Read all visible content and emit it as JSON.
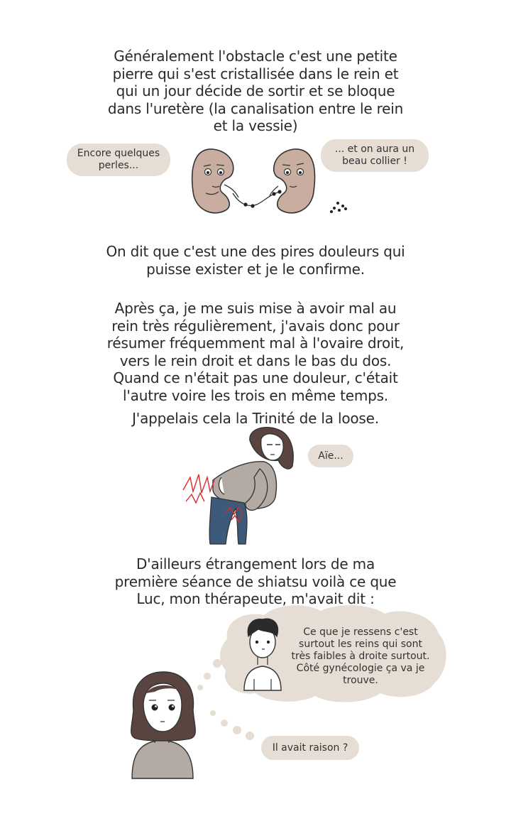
{
  "paragraphs": {
    "p1": "Généralement l'obstacle c'est une petite\npierre qui s'est cristallisée dans le rein et\nqui un jour décide de sortir et se bloque\ndans l'uretère (la canalisation entre le rein\net la vessie)",
    "p2": "On dit que c'est une des pires douleurs qui\npuisse exister et je le confirme.",
    "p3": "Après ça, je me suis mise à avoir mal au\nrein très régulièrement, j'avais donc pour\nrésumer fréquemment mal à l'ovaire droit,\nvers le rein droit et dans le bas du dos.\nQuand ce n'était pas une douleur, c'était\nl'autre voire les trois en même temps.",
    "p4": "J'appelais cela la Trinité de la loose.",
    "p5": "D'ailleurs étrangement lors de ma\npremière séance de shiatsu voilà ce que\nLuc, mon thérapeute, m'avait dit :"
  },
  "bubbles": {
    "kidney_left": "Encore quelques\nperles...",
    "kidney_right": "... et on aura un\nbeau collier !",
    "aie": "Aïe...",
    "therapist": "Ce que je ressens c'est\nsurtout les reins qui sont\ntrès faibles à droite surtout.\nCôté gynécologie ça va je\ntrouve.",
    "reply": "Il avait raison ?"
  },
  "colors": {
    "bubble": "#e6ddd4",
    "kidney": "#c9ada0",
    "hair": "#5a4440",
    "sweater": "#b3aaa3",
    "jeans": "#3d5a7a",
    "pain": "#d92b2b"
  }
}
